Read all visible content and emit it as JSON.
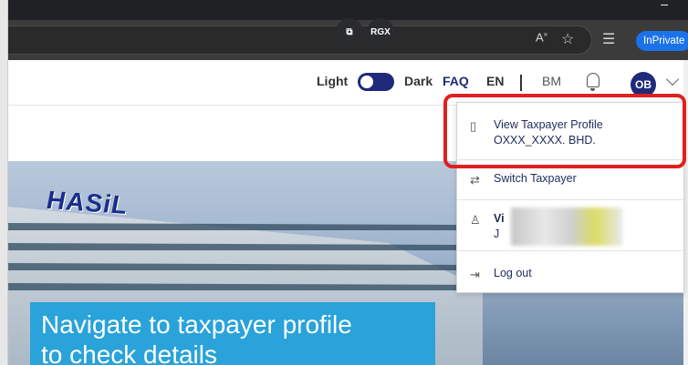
{
  "browser": {
    "floating_buttons": [
      "RGX"
    ],
    "inprivate_label": "InPrivate",
    "icons": [
      "read-aloud-icon",
      "favorite-star-icon",
      "favorites-list-icon"
    ]
  },
  "header": {
    "theme_light": "Light",
    "theme_dark": "Dark",
    "theme_toggle_state": "light",
    "faq": "FAQ",
    "lang_en": "EN",
    "lang_separator": "|",
    "lang_bm": "BM",
    "avatar_initials": "OB"
  },
  "hero": {
    "logo_text": "HASiL",
    "cta_line1": "Navigate to taxpayer profile",
    "cta_line2": "to check details"
  },
  "dropdown": {
    "view_profile_label": "View Taxpayer Profile",
    "company_name": "OXXX_XXXX. BHD.",
    "switch_taxpayer": "Switch Taxpayer",
    "user_line1": "Vi",
    "user_line2": "J",
    "logout": "Log out"
  },
  "colors": {
    "brand_navy": "#1f2a7a",
    "highlight_red": "#e0201f",
    "cta_blue": "#29a3d9",
    "inprivate_blue": "#1a73e8"
  }
}
